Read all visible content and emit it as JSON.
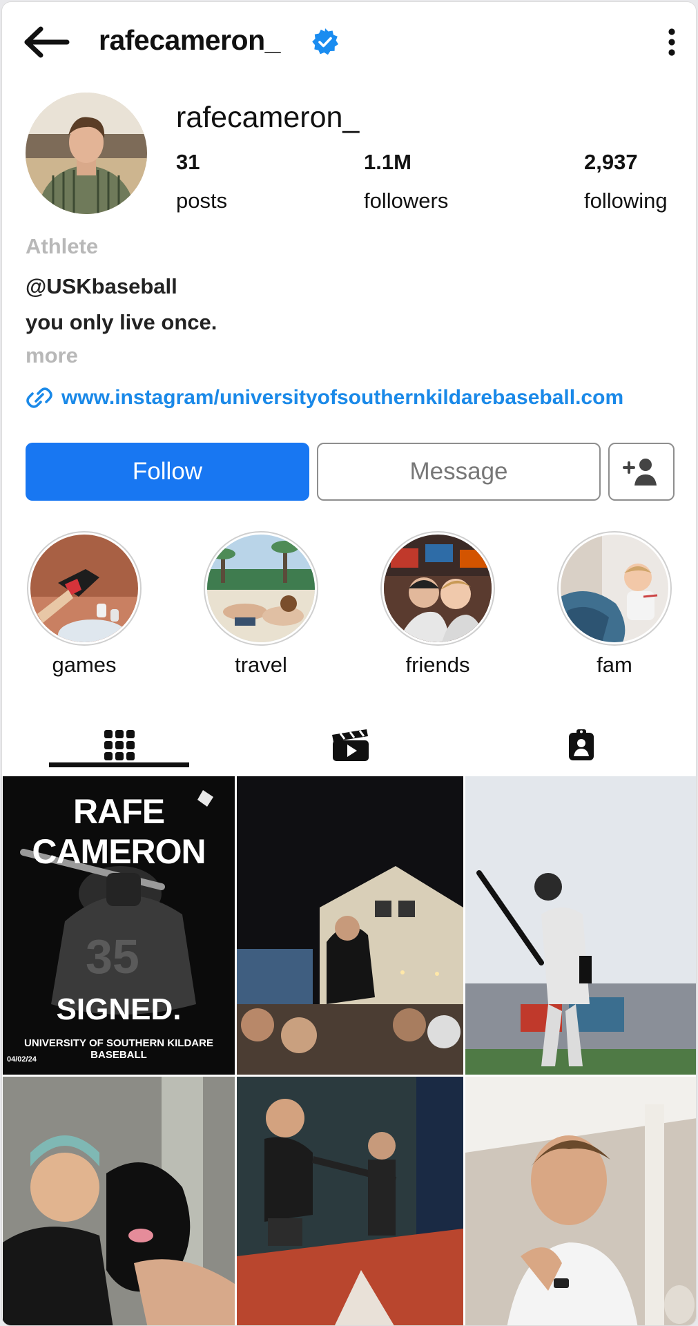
{
  "header": {
    "username": "rafecameron_"
  },
  "profile": {
    "name": "rafecameron_",
    "stats": [
      {
        "value": "31",
        "label": "posts"
      },
      {
        "value": "1.1M",
        "label": "followers"
      },
      {
        "value": "2,937",
        "label": "following"
      }
    ],
    "category": "Athlete",
    "bio_line1": "@USKbaseball",
    "bio_line2": "you only live once.",
    "more": "more",
    "link": "www.instagram/universityofsouthernkildarebaseball.com"
  },
  "actions": {
    "follow": "Follow",
    "message": "Message"
  },
  "highlights": [
    {
      "label": "games"
    },
    {
      "label": "travel"
    },
    {
      "label": "friends"
    },
    {
      "label": "fam"
    }
  ],
  "tabs": [
    {
      "icon": "grid-icon",
      "active": true
    },
    {
      "icon": "reels-icon",
      "active": false
    },
    {
      "icon": "tagged-icon",
      "active": false
    }
  ],
  "posts": {
    "post1_title": "RAFE CAMERON",
    "post1_signed": "SIGNED.",
    "post1_caption": "UNIVERSITY OF SOUTHERN KILDARE BASEBALL",
    "post1_date": "04/02/24"
  },
  "colors": {
    "accent": "#1877f2",
    "link": "#1a89e8",
    "verified": "#1a8cf0"
  }
}
